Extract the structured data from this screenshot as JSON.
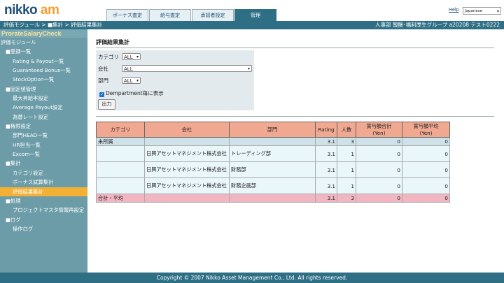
{
  "header": {
    "logo_part1": "nikko",
    "logo_part2": "am",
    "tabs": [
      {
        "label": "ボーナス査定",
        "active": false
      },
      {
        "label": "給与査定",
        "active": false
      },
      {
        "label": "承認者設定",
        "active": false
      },
      {
        "label": "管理",
        "active": true
      }
    ],
    "help_link": "Help",
    "language": "Japanese"
  },
  "topbar": {
    "breadcrumb": "評価モジュール > ■集計 > 評価結果集計",
    "user_info": "人事部 報酬･福利厚生グループ a20208 テスト0222"
  },
  "sidebar": {
    "title": "ProrateSalaryCheck",
    "items": [
      {
        "label": "評価モジュール",
        "level": 0,
        "active": false
      },
      {
        "label": "■登録一覧",
        "level": 1,
        "active": false
      },
      {
        "label": "Rating & Payout一覧",
        "level": 2,
        "active": false
      },
      {
        "label": "Guaranteed Bonus一覧",
        "level": 2,
        "active": false
      },
      {
        "label": "StockOption一覧",
        "level": 2,
        "active": false
      },
      {
        "label": "■固定値管理",
        "level": 1,
        "active": false
      },
      {
        "label": "最大昇給率設定",
        "level": 2,
        "active": false
      },
      {
        "label": "Average Payout設定",
        "level": 2,
        "active": false
      },
      {
        "label": "為替レート設定",
        "level": 2,
        "active": false
      },
      {
        "label": "■権限設定",
        "level": 1,
        "active": false
      },
      {
        "label": "部門HEAD一覧",
        "level": 2,
        "active": false
      },
      {
        "label": "HR担当一覧",
        "level": 2,
        "active": false
      },
      {
        "label": "Excom一覧",
        "level": 2,
        "active": false
      },
      {
        "label": "■集計",
        "level": 1,
        "active": false
      },
      {
        "label": "カテゴリ設定",
        "level": 2,
        "active": false
      },
      {
        "label": "ボーナス試算集計",
        "level": 2,
        "active": false
      },
      {
        "label": "評価結果集計",
        "level": 2,
        "active": true
      },
      {
        "label": "■処理",
        "level": 1,
        "active": false
      },
      {
        "label": "プロジェクトマスタ情報再設定",
        "level": 2,
        "active": false
      },
      {
        "label": "■ログ",
        "level": 1,
        "active": false
      },
      {
        "label": "操作ログ",
        "level": 2,
        "active": false
      }
    ]
  },
  "main": {
    "title": "評価結果集計",
    "filter": {
      "category_label": "カテゴリ",
      "category_value": "ALL",
      "company_label": "会社",
      "company_value": "ALL",
      "department_label": "部門",
      "department_value": "ALL",
      "checkbox_label": "Dempartment毎に表示",
      "checkbox_checked": true,
      "output_button": "出力"
    },
    "table": {
      "headers": [
        "カテゴリ",
        "会社",
        "部門",
        "Rating",
        "人数",
        "賞与額合計\n(Yen)",
        "賞与額平均\n(Yen)"
      ],
      "rows": [
        {
          "type": "unassigned",
          "category": "未所属",
          "company": "",
          "department": "",
          "rating": "3.1",
          "count": "3",
          "total": "0",
          "avg": "0"
        },
        {
          "type": "data",
          "category": "",
          "company": "日興アセットマネジメント株式会社",
          "department": "トレーディング部",
          "rating": "3.1",
          "count": "1",
          "total": "0",
          "avg": "0"
        },
        {
          "type": "data",
          "category": "",
          "company": "日興アセットマネジメント株式会社",
          "department": "財務部",
          "rating": "3.1",
          "count": "1",
          "total": "0",
          "avg": "0"
        },
        {
          "type": "data",
          "category": "",
          "company": "日興アセットマネジメント株式会社",
          "department": "財務企画部",
          "rating": "3.1",
          "count": "1",
          "total": "0",
          "avg": "0"
        },
        {
          "type": "total",
          "category": "合計・平均",
          "company": "",
          "department": "",
          "rating": "3.1",
          "count": "3",
          "total": "0",
          "avg": "0"
        }
      ]
    }
  },
  "footer": {
    "copyright": "Copyright © 2007 Nikko Asset Management Co., Ltd. All rights reserved."
  }
}
